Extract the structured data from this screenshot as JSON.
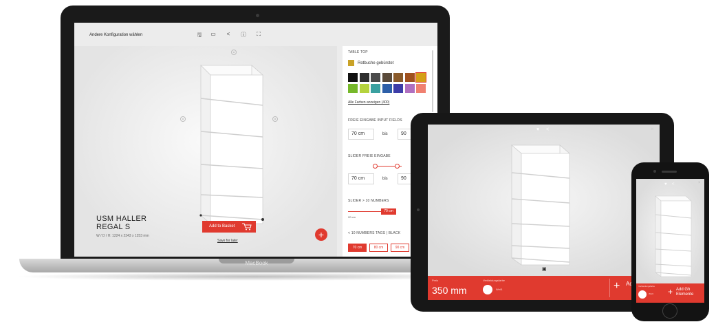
{
  "laptop": {
    "brand_label": "MacBook",
    "topbar": {
      "back_link": "Andere Konfiguration wählen",
      "tools": [
        {
          "icon": "save-icon",
          "glyph": "🖫"
        },
        {
          "icon": "folder-icon",
          "glyph": "▭"
        },
        {
          "icon": "share-icon",
          "glyph": "<"
        },
        {
          "icon": "info-icon",
          "glyph": "ⓘ"
        },
        {
          "icon": "fullscreen-icon",
          "glyph": "⛶"
        }
      ]
    },
    "product": {
      "title_line1": "USM HALLER",
      "title_line2": "REGAL S",
      "dimensions": "W / D / H: 1224 x 2343 x 1253 mm"
    },
    "add_to_basket": "Add to Basket",
    "save_for_later": "Save for later",
    "fab_label": "+",
    "panel": {
      "table_top_header": "TABLE TOP",
      "selected_color_name": "Rotbuche gebürstet",
      "selected_color": "#c9a227",
      "swatches_row1": [
        "#111111",
        "#2e2e2e",
        "#4a4a4a",
        "#5a4a3a",
        "#8a5a2a",
        "#a0511f",
        "#d4a017"
      ],
      "swatches_row2": [
        "#76b82a",
        "#b5d33d",
        "#3aa0a0",
        "#2d5fa8",
        "#3d3da8",
        "#b070c0",
        "#f08070"
      ],
      "all_colors_link": "Alle Farben anzeigen (400)",
      "free_input_header": "FREIE EINGABE INPUT FIELDS",
      "input_from": "70 cm",
      "input_to": "90",
      "bis": "bis",
      "slider_free_header": "SLIDER FREIE EINGABE",
      "slider_input_from": "70 cm",
      "slider_input_to": "90",
      "slider_bis": "bis",
      "slider_numbers_header": "SLIDER > 10 NUMBERS",
      "slider_min_label": "20 cm",
      "slider_value_label": "70 cm",
      "tags_header": "< 10 NUMBERS TAGS | BLACK",
      "tags": [
        "70 cm",
        "80 cm",
        "90 cm"
      ]
    }
  },
  "tablet": {
    "price_label": "Preis",
    "price": "350 mm",
    "color_label": "Verkleidungsfarbe",
    "color_name": "Weiß",
    "add_label": "Add Element",
    "plus": "+",
    "heart_icon": "♥",
    "share_icon": "<",
    "close_icon": "×",
    "badge": "▣"
  },
  "phone": {
    "color_label": "Verkleidungsfarbe",
    "color_name": "Weiß",
    "add_label_line1": "Add Gh",
    "add_label_line2": "Elemente",
    "plus": "+",
    "heart_icon": "♥",
    "share_icon": "<",
    "close_icon": "×"
  }
}
